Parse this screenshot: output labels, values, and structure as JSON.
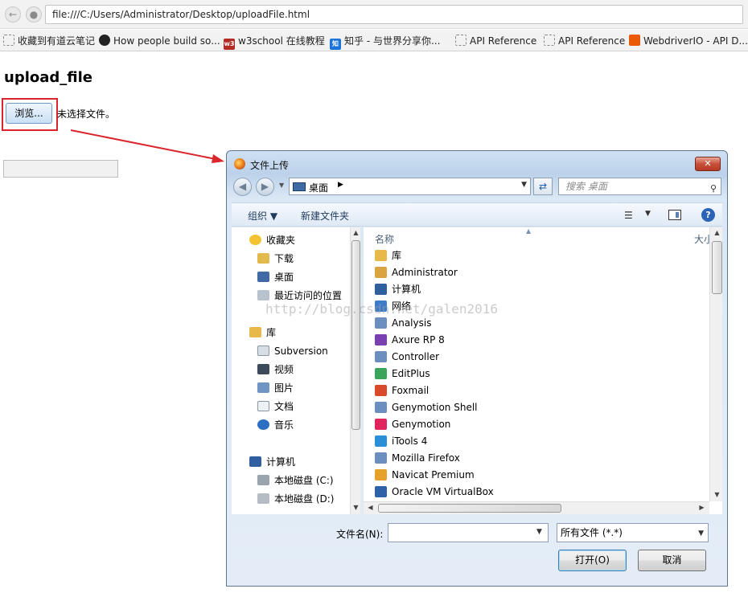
{
  "browser": {
    "url": "file:///C:/Users/Administrator/Desktop/uploadFile.html",
    "bookmarks": [
      {
        "label": "收藏到有道云笔记",
        "icon": "bookmark-icon"
      },
      {
        "label": "How people build so...",
        "icon": "github-icon"
      },
      {
        "label": "w3school 在线教程",
        "icon": "w3school-icon",
        "badge": "w3"
      },
      {
        "label": "知乎 - 与世界分享你...",
        "icon": "zhihu-icon",
        "badge": "知"
      },
      {
        "label": "API Reference",
        "icon": "page-icon"
      },
      {
        "label": "API Reference",
        "icon": "page-icon"
      },
      {
        "label": "WebdriverIO - API D...",
        "icon": "webdriverio-icon"
      }
    ]
  },
  "page": {
    "title": "upload_file",
    "browse_button": "浏览...",
    "file_status": "未选择文件。"
  },
  "dialog": {
    "title": "文件上传",
    "close": "✕",
    "location": "桌面",
    "search_placeholder": "搜索 桌面",
    "organize": "组织 ▼",
    "new_folder": "新建文件夹",
    "nav": [
      {
        "label": "收藏夹",
        "icon": "favorites-star-icon"
      },
      {
        "label": "下载",
        "icon": "downloads-folder-icon"
      },
      {
        "label": "桌面",
        "icon": "desktop-icon"
      },
      {
        "label": "最近访问的位置",
        "icon": "recent-places-icon"
      },
      {
        "label": "库",
        "icon": "libraries-icon"
      },
      {
        "label": "Subversion",
        "icon": "subversion-icon"
      },
      {
        "label": "视频",
        "icon": "videos-icon"
      },
      {
        "label": "图片",
        "icon": "pictures-icon"
      },
      {
        "label": "文档",
        "icon": "documents-icon"
      },
      {
        "label": "音乐",
        "icon": "music-icon"
      },
      {
        "label": "计算机",
        "icon": "computer-icon"
      },
      {
        "label": "本地磁盘 (C:)",
        "icon": "local-disk-c-icon"
      },
      {
        "label": "本地磁盘 (D:)",
        "icon": "local-disk-d-icon"
      }
    ],
    "columns": {
      "name": "名称",
      "size": "大小"
    },
    "files": [
      {
        "name": "库",
        "icon": "library-folder-icon",
        "color": "#e8b84a"
      },
      {
        "name": "Administrator",
        "icon": "user-folder-icon",
        "color": "#d9a441"
      },
      {
        "name": "计算机",
        "icon": "computer-icon",
        "color": "#2f5f9e"
      },
      {
        "name": "网络",
        "icon": "network-icon",
        "color": "#3e7bc8"
      },
      {
        "name": "Analysis",
        "icon": "shortcut-app-icon",
        "color": "#6b8fbf"
      },
      {
        "name": "Axure RP 8",
        "icon": "axure-icon",
        "color": "#7a3fb0"
      },
      {
        "name": "Controller",
        "icon": "shortcut-app-icon",
        "color": "#6b8fbf"
      },
      {
        "name": "EditPlus",
        "icon": "editplus-icon",
        "color": "#3aa55a"
      },
      {
        "name": "Foxmail",
        "icon": "foxmail-icon",
        "color": "#d84a2b"
      },
      {
        "name": "Genymotion Shell",
        "icon": "shortcut-app-icon",
        "color": "#6b8fbf"
      },
      {
        "name": "Genymotion",
        "icon": "genymotion-icon",
        "color": "#e0245e"
      },
      {
        "name": "iTools 4",
        "icon": "itools-icon",
        "color": "#2a8fd6"
      },
      {
        "name": "Mozilla Firefox",
        "icon": "shortcut-app-icon",
        "color": "#6b8fbf"
      },
      {
        "name": "Navicat Premium",
        "icon": "navicat-icon",
        "color": "#e5a12a"
      },
      {
        "name": "Oracle VM VirtualBox",
        "icon": "virtualbox-icon",
        "color": "#2e62a8"
      }
    ],
    "filename_label": "文件名(N):",
    "filename_value": "",
    "filter": "所有文件 (*.*)",
    "open_button": "打开(O)",
    "cancel_button": "取消"
  },
  "watermark": "http://blog.csdn.net/galen2016",
  "colors": {
    "annotation_red": "#d9252b",
    "dialog_frame": "#5a7796"
  }
}
